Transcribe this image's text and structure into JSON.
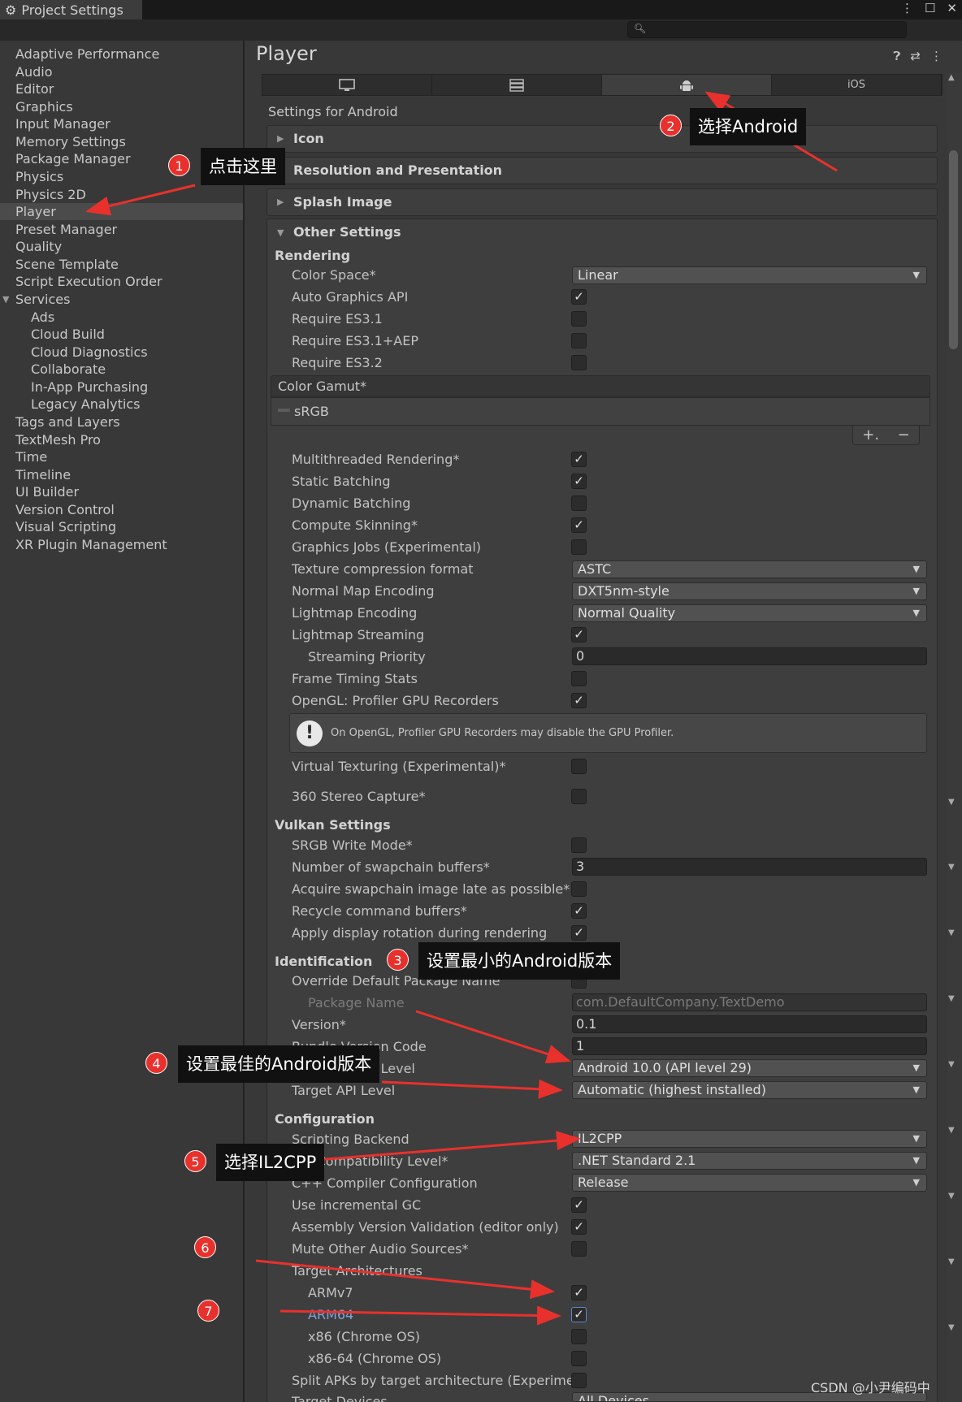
{
  "window": {
    "tab_title": "Project Settings"
  },
  "sidebar": {
    "items": [
      {
        "label": "Adaptive Performance"
      },
      {
        "label": "Audio"
      },
      {
        "label": "Editor"
      },
      {
        "label": "Graphics"
      },
      {
        "label": "Input Manager"
      },
      {
        "label": "Memory Settings"
      },
      {
        "label": "Package Manager"
      },
      {
        "label": "Physics"
      },
      {
        "label": "Physics 2D"
      },
      {
        "label": "Player"
      },
      {
        "label": "Preset Manager"
      },
      {
        "label": "Quality"
      },
      {
        "label": "Scene Template"
      },
      {
        "label": "Script Execution Order"
      },
      {
        "label": "Services"
      },
      {
        "label": "Ads"
      },
      {
        "label": "Cloud Build"
      },
      {
        "label": "Cloud Diagnostics"
      },
      {
        "label": "Collaborate"
      },
      {
        "label": "In-App Purchasing"
      },
      {
        "label": "Legacy Analytics"
      },
      {
        "label": "Tags and Layers"
      },
      {
        "label": "TextMesh Pro"
      },
      {
        "label": "Time"
      },
      {
        "label": "Timeline"
      },
      {
        "label": "UI Builder"
      },
      {
        "label": "Version Control"
      },
      {
        "label": "Visual Scripting"
      },
      {
        "label": "XR Plugin Management"
      }
    ],
    "selected": "Player"
  },
  "main": {
    "title": "Player",
    "platform_tabs": [
      {
        "name": "standalone",
        "label": ""
      },
      {
        "name": "webgl",
        "label": ""
      },
      {
        "name": "android",
        "label": ""
      },
      {
        "name": "ios",
        "label": "iOS"
      }
    ],
    "active_platform": "android",
    "settings_for": "Settings for Android",
    "foldouts": {
      "icon": "Icon",
      "resolution": "Resolution and Presentation",
      "splash": "Splash Image",
      "other": "Other Settings"
    },
    "sections": {
      "rendering": "Rendering",
      "vulkan": "Vulkan Settings",
      "identification": "Identification",
      "configuration": "Configuration"
    },
    "rendering": {
      "color_space": {
        "label": "Color Space*",
        "value": "Linear"
      },
      "auto_graphics_api": {
        "label": "Auto Graphics API",
        "checked": true
      },
      "require_es31": {
        "label": "Require ES3.1",
        "checked": false
      },
      "require_es31_aep": {
        "label": "Require ES3.1+AEP",
        "checked": false
      },
      "require_es32": {
        "label": "Require ES3.2",
        "checked": false
      },
      "color_gamut": {
        "label": "Color Gamut*",
        "items": [
          "sRGB"
        ]
      },
      "multithreaded": {
        "label": "Multithreaded Rendering*",
        "checked": true
      },
      "static_batching": {
        "label": "Static Batching",
        "checked": true
      },
      "dynamic_batching": {
        "label": "Dynamic Batching",
        "checked": false
      },
      "compute_skinning": {
        "label": "Compute Skinning*",
        "checked": true
      },
      "graphics_jobs": {
        "label": "Graphics Jobs (Experimental)",
        "checked": false
      },
      "texture_compression": {
        "label": "Texture compression format",
        "value": "ASTC"
      },
      "normal_map": {
        "label": "Normal Map Encoding",
        "value": "DXT5nm-style"
      },
      "lightmap_encoding": {
        "label": "Lightmap Encoding",
        "value": "Normal Quality"
      },
      "lightmap_streaming": {
        "label": "Lightmap Streaming",
        "checked": true
      },
      "streaming_priority": {
        "label": "Streaming Priority",
        "value": "0"
      },
      "frame_timing": {
        "label": "Frame Timing Stats",
        "checked": false
      },
      "opengl_profiler": {
        "label": "OpenGL: Profiler GPU Recorders",
        "checked": true
      },
      "help_text": "On OpenGL, Profiler GPU Recorders may disable the GPU Profiler.",
      "virtual_texturing": {
        "label": "Virtual Texturing (Experimental)*",
        "checked": false
      },
      "stereo_capture": {
        "label": "360 Stereo Capture*",
        "checked": false
      }
    },
    "vulkan": {
      "srgb_write": {
        "label": "SRGB Write Mode*",
        "checked": false
      },
      "swapchain_buffers": {
        "label": "Number of swapchain buffers*",
        "value": "3"
      },
      "acquire_late": {
        "label": "Acquire swapchain image late as possible*",
        "checked": false
      },
      "recycle_buffers": {
        "label": "Recycle command buffers*",
        "checked": true
      },
      "display_rotation": {
        "label": "Apply display rotation during rendering",
        "checked": true
      }
    },
    "identification": {
      "override_package": {
        "label": "Override Default Package Name",
        "checked": false
      },
      "package_name": {
        "label": "Package Name",
        "value": "com.DefaultCompany.TextDemo"
      },
      "version": {
        "label": "Version*",
        "value": "0.1"
      },
      "bundle_code": {
        "label": "Bundle Version Code",
        "value": "1"
      },
      "min_api": {
        "label": "Minimum API Level",
        "value": "Android 10.0 (API level 29)"
      },
      "target_api": {
        "label": "Target API Level",
        "value": "Automatic (highest installed)"
      }
    },
    "configuration": {
      "scripting_backend": {
        "label": "Scripting Backend",
        "value": "IL2CPP"
      },
      "api_compat": {
        "label": "Api Compatibility Level*",
        "value": ".NET Standard 2.1"
      },
      "cpp_config": {
        "label": "C++ Compiler Configuration",
        "value": "Release"
      },
      "incremental_gc": {
        "label": "Use incremental GC",
        "checked": true
      },
      "assembly_validation": {
        "label": "Assembly Version Validation (editor only)",
        "checked": true
      },
      "mute_audio": {
        "label": "Mute Other Audio Sources*",
        "checked": false
      },
      "target_arch": {
        "label": "Target Architectures"
      },
      "armv7": {
        "label": "ARMv7",
        "checked": true
      },
      "arm64": {
        "label": "ARM64",
        "checked": true
      },
      "x86": {
        "label": "x86 (Chrome OS)",
        "checked": false
      },
      "x86_64": {
        "label": "x86-64 (Chrome OS)",
        "checked": false
      },
      "split_apks": {
        "label": "Split APKs by target architecture (Experimen",
        "checked": false
      },
      "target_devices": {
        "label": "Target Devices",
        "value": "All Devices"
      }
    }
  },
  "annotations": {
    "badges": [
      "1",
      "2",
      "3",
      "4",
      "5",
      "6",
      "7"
    ],
    "callouts": {
      "c1": "点击这里",
      "c2": "选择Android",
      "c3": "设置最小的Android版本",
      "c4": "设置最佳的Android版本",
      "c5": "选择IL2CPP"
    },
    "arrow_color": "#e8312c"
  },
  "watermark": "CSDN @小尹编码中"
}
